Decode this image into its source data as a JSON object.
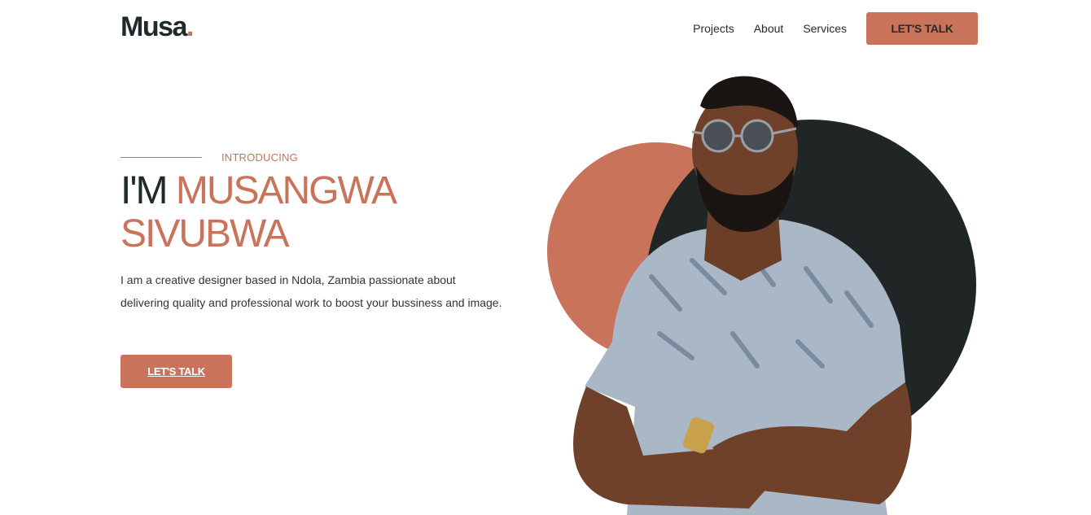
{
  "brand": {
    "name": "Musa",
    "dot": ".",
    "accent_color": "#c8735a",
    "dark_color": "#1f2a2b"
  },
  "nav": {
    "links": [
      "Projects",
      "About",
      "Services"
    ],
    "cta": "LET'S TALK"
  },
  "hero": {
    "eyebrow": "INTRODUCING",
    "headline_prefix": "I'M",
    "headline_name_line1": "MUSANGWA",
    "headline_name_line2": "SIVUBWA",
    "description": "I am a creative designer based in Ndola, Zambia passionate about delivering quality and professional work to boost your bussiness and image.",
    "cta": "LET'S TALK"
  },
  "portrait": {
    "subject": "man-with-sunglasses-arms-crossed"
  }
}
